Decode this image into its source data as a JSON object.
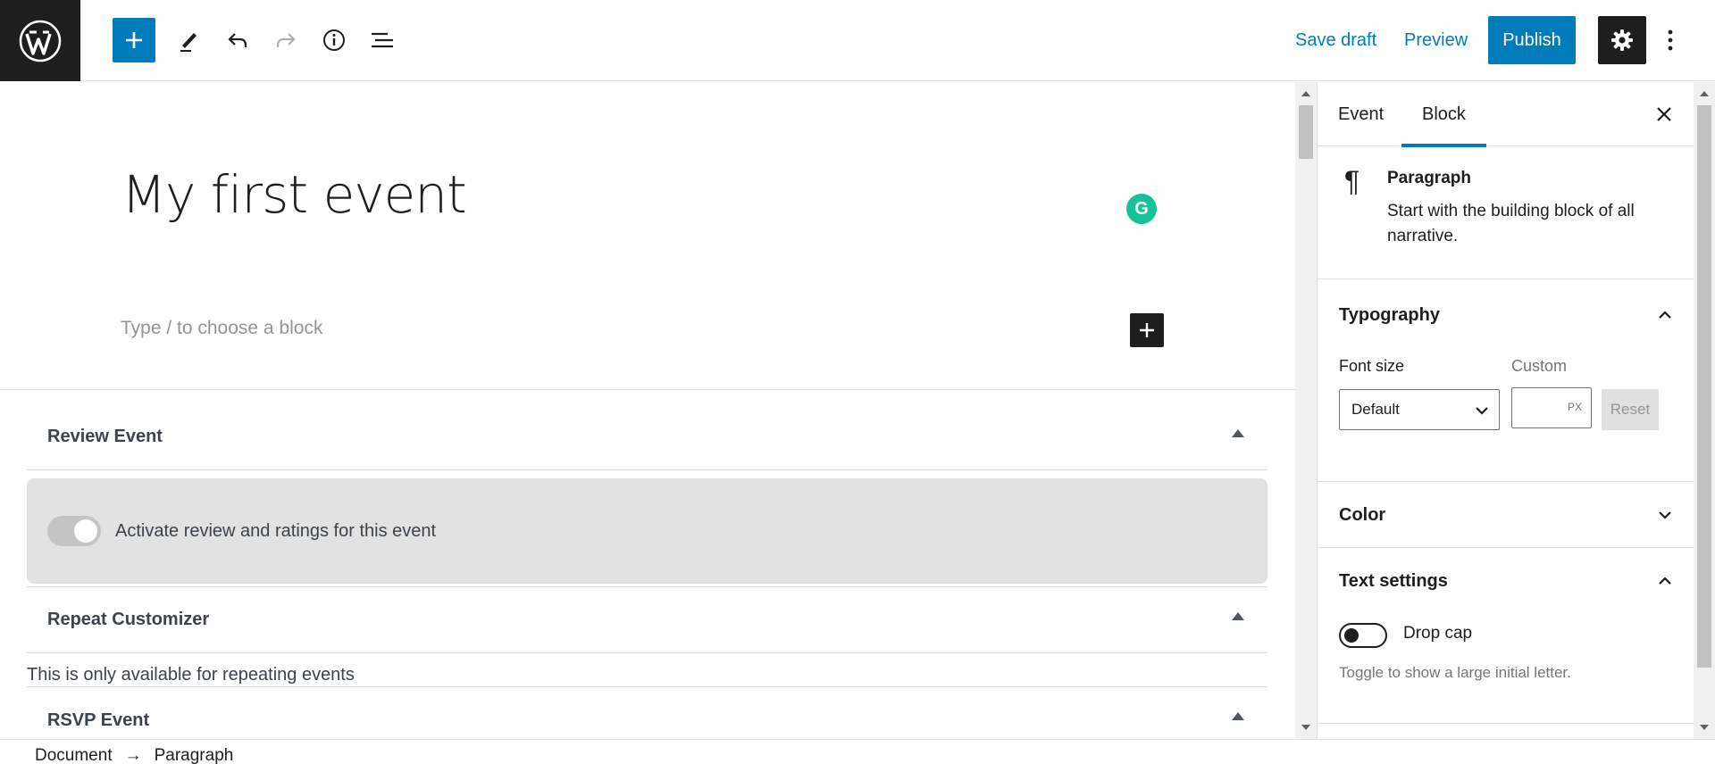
{
  "toolbar": {
    "save_draft": "Save draft",
    "preview": "Preview",
    "publish": "Publish"
  },
  "editor": {
    "title": "My first event",
    "block_placeholder": "Type / to choose a block"
  },
  "metaboxes": {
    "review_title": "Review Event",
    "review_toggle_label": "Activate review and ratings for this event",
    "repeat_title": "Repeat Customizer",
    "repeat_note": "This is only available for repeating events",
    "rsvp_title": "RSVP Event"
  },
  "sidebar": {
    "tabs": [
      {
        "label": "Event"
      },
      {
        "label": "Block"
      }
    ],
    "block": {
      "name": "Paragraph",
      "description": "Start with the building block of all narrative."
    },
    "typography": {
      "title": "Typography",
      "font_size_label": "Font size",
      "custom_label": "Custom",
      "select_value": "Default",
      "unit": "PX",
      "reset": "Reset"
    },
    "color": {
      "title": "Color"
    },
    "text_settings": {
      "title": "Text settings",
      "drop_cap_label": "Drop cap",
      "drop_cap_help": "Toggle to show a large initial letter."
    }
  },
  "breadcrumb": {
    "items": [
      "Document",
      "Paragraph"
    ],
    "separator": "→"
  },
  "colors": {
    "accent": "#007cba",
    "dark": "#1e1e1e",
    "grammarly": "#15c39a"
  }
}
